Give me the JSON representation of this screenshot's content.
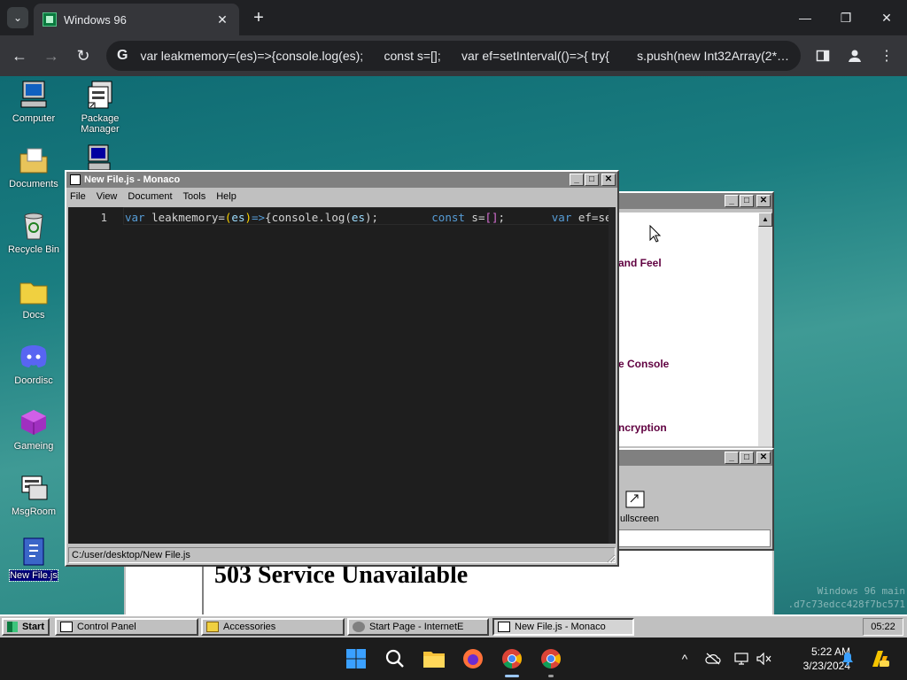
{
  "browser": {
    "tab_title": "Windows 96",
    "tab_close": "✕",
    "new_tab": "+",
    "url": "var leakmemory=(es)=>{console.log(es);      const s=[];      var ef=setInterval(()=>{ try{        s.push(new Int32Array(2*…",
    "omnibox_icon": "G",
    "controls": {
      "minimize": "—",
      "restore": "❐",
      "close": "✕"
    }
  },
  "desktop_icons": [
    {
      "label": "Computer",
      "icon": "computer-icon"
    },
    {
      "label": "Package Manager",
      "icon": "package-icon"
    },
    {
      "label": "Documents",
      "icon": "folder-documents-icon"
    },
    {
      "label": "Recycle Bin",
      "icon": "recycle-bin-icon"
    },
    {
      "label": "Docs",
      "icon": "folder-icon"
    },
    {
      "label": "Doordisc",
      "icon": "discord-icon"
    },
    {
      "label": "Gameing",
      "icon": "game-icon"
    },
    {
      "label": "MsgRoom",
      "icon": "chat-icon"
    },
    {
      "label": "New File.js",
      "icon": "script-file-icon"
    }
  ],
  "editor": {
    "title": "New File.js - Monaco",
    "menu": [
      "File",
      "View",
      "Document",
      "Tools",
      "Help"
    ],
    "line_number": "1",
    "code": {
      "t1": "var",
      "t2": " leakmemory=",
      "t3": "(",
      "t4": "es",
      "t5": ")",
      "t6": "=>",
      "t7": "{console.log(",
      "t8": "es",
      "t9": ");",
      "t10": "const",
      "t11": " s=",
      "t12": "[]",
      "t13": ";",
      "t14": "var",
      "t15": " ef=setI"
    },
    "status_path": "C:/user/desktop/New File.js"
  },
  "bg_window": {
    "items": [
      "and Feel",
      "e Console",
      "ncryption"
    ]
  },
  "bg_window2": {
    "fullscreen_label": "ullscreen"
  },
  "browser_page": {
    "heading": "503 Service Unavailable"
  },
  "watermark": {
    "line1": "Windows 96 main",
    "line2": ".d7c73edcc428f7bc571"
  },
  "w96_taskbar": {
    "start": "Start",
    "tasks": [
      "Control Panel",
      "Accessories",
      "Start Page - InternetE",
      "New File.js - Monaco"
    ],
    "clock": "05:22"
  },
  "w11": {
    "time": "5:22 AM",
    "date": "3/23/2024",
    "tray_up": "^"
  }
}
